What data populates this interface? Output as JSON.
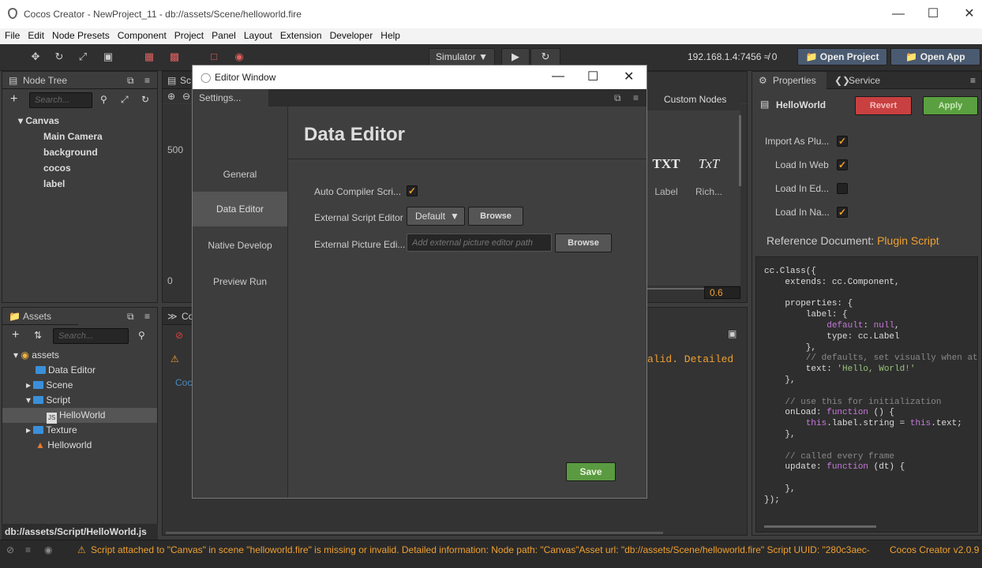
{
  "window": {
    "title": "Cocos Creator - NewProject_11 - db://assets/Scene/helloworld.fire"
  },
  "menu": [
    "File",
    "Edit",
    "Node Presets",
    "Component",
    "Project",
    "Panel",
    "Layout",
    "Extension",
    "Developer",
    "Help"
  ],
  "toolbar": {
    "simulator": "Simulator",
    "ip": "192.168.1.4:7456",
    "count": "0",
    "open_project": "Open Project",
    "open_app": "Open App"
  },
  "node_tree": {
    "title": "Node Tree",
    "search_placeholder": "Search...",
    "root": "Canvas",
    "children": [
      "Main Camera",
      "background",
      "cocos",
      "label"
    ]
  },
  "scene": {
    "tab": "Sc",
    "y_tick_500": "500",
    "y_tick_0": "0",
    "zoom": "0.6"
  },
  "node_library": {
    "tab": "Custom Nodes",
    "items": [
      {
        "icon": "TXT",
        "label": "Label"
      },
      {
        "icon": "TxT",
        "label": "Rich..."
      }
    ]
  },
  "assets": {
    "title": "Assets",
    "search_placeholder": "Search...",
    "root": "assets",
    "items": [
      "Data Editor",
      "Scene",
      "Script",
      "HelloWorld",
      "Texture",
      "Helloworld"
    ],
    "path": "db://assets/Script/HelloWorld.js"
  },
  "console": {
    "tab": "Co",
    "msg1": "alid. Detailed",
    "msg2": "Coc"
  },
  "dialog": {
    "title": "Editor Window",
    "tab": "Settings...",
    "nav": [
      "General",
      "Data Editor",
      "Native Develop",
      "Preview Run"
    ],
    "heading": "Data Editor",
    "auto_compiler_label": "Auto Compiler Scri...",
    "ext_script_label": "External Script Editor",
    "ext_script_value": "Default",
    "browse": "Browse",
    "ext_picture_label": "External Picture Edi...",
    "ext_picture_placeholder": "Add external picture editor path",
    "save": "Save"
  },
  "properties": {
    "tab_properties": "Properties",
    "tab_service": "Service",
    "name": "HelloWorld",
    "revert": "Revert",
    "apply": "Apply",
    "checks": [
      {
        "label": "Import As Plu...",
        "checked": true
      },
      {
        "label": "Load In Web",
        "checked": true
      },
      {
        "label": "Load In Ed...",
        "checked": false
      },
      {
        "label": "Load In Na...",
        "checked": true
      }
    ],
    "ref_label": "Reference Document:",
    "ref_link": "Plugin Script"
  },
  "status": {
    "message": "Script attached to \"Canvas\" in scene \"helloworld.fire\" is missing or invalid. Detailed information: Node path: \"Canvas\"Asset url: \"db://assets/Scene/helloworld.fire\" Script UUID: \"280c3aec-",
    "version": "Cocos Creator v2.0.9"
  },
  "colors": {
    "accent": "#f0a030",
    "revert": "#c84040",
    "apply": "#5aa040",
    "save": "#5a9a40",
    "link": "#f0a030"
  }
}
